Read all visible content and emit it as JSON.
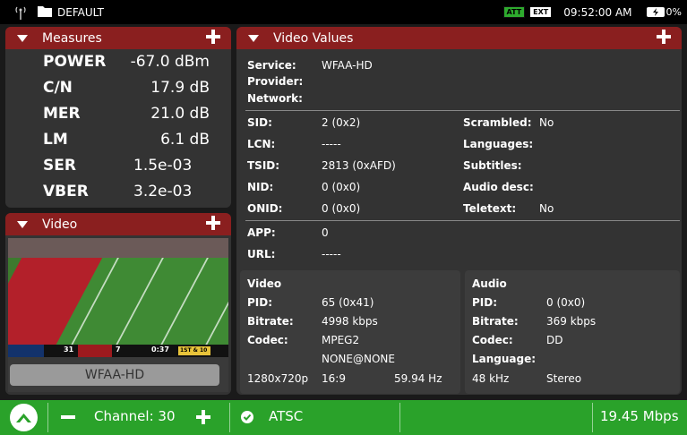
{
  "status": {
    "profile": "DEFAULT",
    "tag1": "ATT",
    "tag2": "EXT",
    "time": "09:52:00 AM",
    "battery": "0%"
  },
  "measures": {
    "title": "Measures",
    "rows": [
      {
        "label": "POWER",
        "value": "-67.0 dBm"
      },
      {
        "label": "C/N",
        "value": "17.9 dB"
      },
      {
        "label": "MER",
        "value": "21.0 dB"
      },
      {
        "label": "LM",
        "value": "6.1 dB"
      },
      {
        "label": "SER",
        "value": "1.5e-03"
      },
      {
        "label": "VBER",
        "value": "3.2e-03"
      }
    ]
  },
  "video": {
    "title": "Video",
    "service_badge": "WFAA-HD",
    "scoreboard": {
      "away": "31",
      "home": "7",
      "clock": "0:37",
      "down": "1ST & 10"
    }
  },
  "video_values": {
    "title": "Video Values",
    "service_label": "Service:",
    "service": "WFAA-HD",
    "provider_label": "Provider:",
    "provider": "",
    "network_label": "Network:",
    "network": "",
    "sid_label": "SID:",
    "sid": "2 (0x2)",
    "lcn_label": "LCN:",
    "lcn": "-----",
    "tsid_label": "TSID:",
    "tsid": "2813 (0xAFD)",
    "nid_label": "NID:",
    "nid": "0 (0x0)",
    "onid_label": "ONID:",
    "onid": "0 (0x0)",
    "scrambled_label": "Scrambled:",
    "scrambled": "No",
    "languages_label": "Languages:",
    "languages": "",
    "subtitles_label": "Subtitles:",
    "subtitles": "",
    "audio_desc_label": "Audio desc:",
    "audio_desc": "",
    "teletext_label": "Teletext:",
    "teletext": "No",
    "app_label": "APP:",
    "app": "0",
    "url_label": "URL:",
    "url": "-----",
    "video": {
      "heading": "Video",
      "pid_label": "PID:",
      "pid": "65 (0x41)",
      "bitrate_label": "Bitrate:",
      "bitrate": "4998 kbps",
      "codec_label": "Codec:",
      "codec": "MPEG2",
      "codec_extra": "NONE@NONE",
      "resolution": "1280x720p",
      "aspect": "16:9",
      "framerate": "59.94 Hz"
    },
    "audio": {
      "heading": "Audio",
      "pid_label": "PID:",
      "pid": "0 (0x0)",
      "bitrate_label": "Bitrate:",
      "bitrate": "369 kbps",
      "codec_label": "Codec:",
      "codec": "DD",
      "language_label": "Language:",
      "language": "",
      "samplerate": "48 kHz",
      "channels": "Stereo"
    }
  },
  "bottom": {
    "channel": "Channel: 30",
    "standard": "ATSC",
    "bitrate": "19.45 Mbps"
  }
}
